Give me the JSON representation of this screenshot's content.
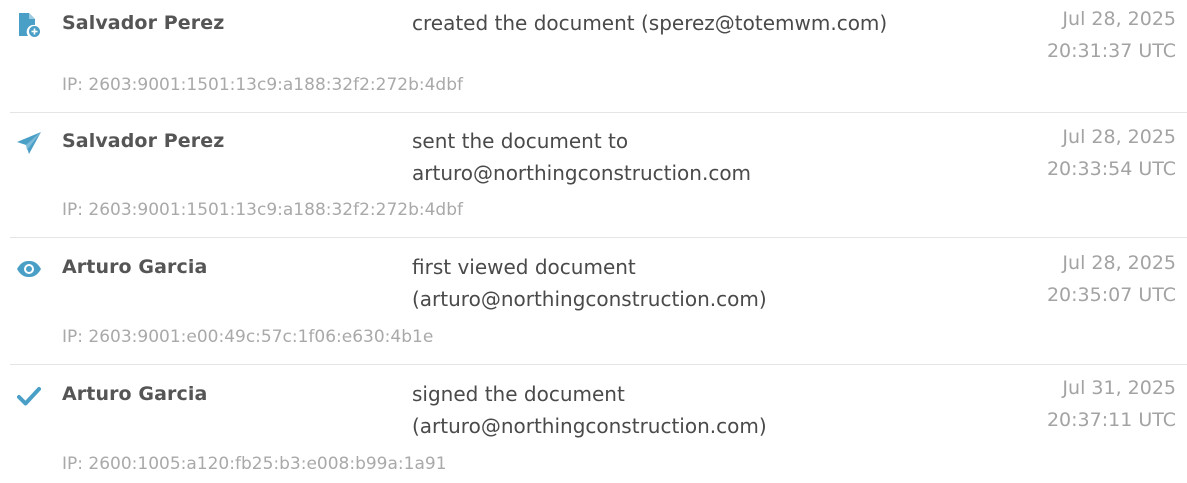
{
  "colors": {
    "icon_accent": "#4a9fc7",
    "actor_text": "#555555",
    "action_text": "#4a4a4a",
    "muted_text": "#a3a3a3",
    "divider": "#e3e5e7"
  },
  "events": [
    {
      "icon": "document-created-icon",
      "actor": "Salvador Perez",
      "action_line1": "created the document (sperez@totemwm.com)",
      "action_line2": "",
      "date": "Jul 28, 2025",
      "time": "20:31:37 UTC",
      "ip": "IP: 2603:9001:1501:13c9:a188:32f2:272b:4dbf"
    },
    {
      "icon": "paper-plane-icon",
      "actor": "Salvador Perez",
      "action_line1": "sent the document to",
      "action_line2": "arturo@northingconstruction.com",
      "date": "Jul 28, 2025",
      "time": "20:33:54 UTC",
      "ip": "IP: 2603:9001:1501:13c9:a188:32f2:272b:4dbf"
    },
    {
      "icon": "eye-icon",
      "actor": "Arturo Garcia",
      "action_line1": "first viewed document",
      "action_line2": "(arturo@northingconstruction.com)",
      "date": "Jul 28, 2025",
      "time": "20:35:07 UTC",
      "ip": "IP: 2603:9001:e00:49c:57c:1f06:e630:4b1e"
    },
    {
      "icon": "checkmark-icon",
      "actor": "Arturo Garcia",
      "action_line1": "signed the document",
      "action_line2": "(arturo@northingconstruction.com)",
      "date": "Jul 31, 2025",
      "time": "20:37:11 UTC",
      "ip": "IP: 2600:1005:a120:fb25:b3:e008:b99a:1a91"
    }
  ]
}
